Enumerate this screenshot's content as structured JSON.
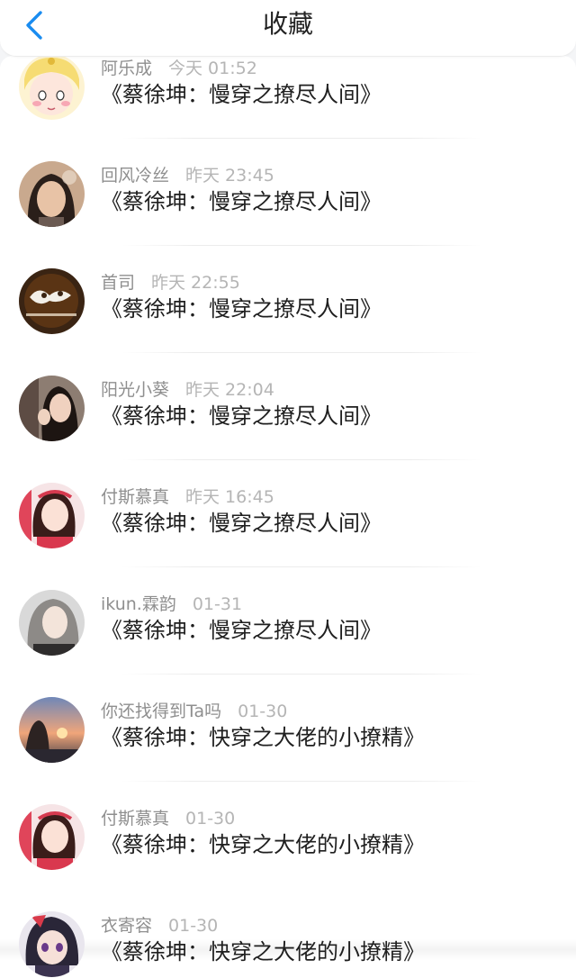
{
  "header": {
    "title": "收藏"
  },
  "items": [
    {
      "name": "阿乐成",
      "time": "今天 01:52",
      "work": "《蔡徐坤：慢穿之撩尽人间》",
      "avatar": "anime-girl-avatar"
    },
    {
      "name": "回风冷丝",
      "time": "昨天 23:45",
      "work": "《蔡徐坤：慢穿之撩尽人间》",
      "avatar": "woman-photo-avatar"
    },
    {
      "name": "首司",
      "time": "昨天 22:55",
      "work": "《蔡徐坤：慢穿之撩尽人间》",
      "avatar": "dark-logo-avatar"
    },
    {
      "name": "阳光小葵",
      "time": "昨天 22:04",
      "work": "《蔡徐坤：慢穿之撩尽人间》",
      "avatar": "girl-photo-avatar"
    },
    {
      "name": "付斯慕真",
      "time": "昨天 16:45",
      "work": "《蔡徐坤：慢穿之撩尽人间》",
      "avatar": "girl-red-avatar"
    },
    {
      "name": "ikun.霖韵",
      "time": "01-31",
      "work": "《蔡徐坤：慢穿之撩尽人间》",
      "avatar": "girl-grey-avatar"
    },
    {
      "name": "你还找得到Ta吗",
      "time": "01-30",
      "work": "《蔡徐坤：快穿之大佬的小撩精》",
      "avatar": "sunset-avatar"
    },
    {
      "name": "付斯慕真",
      "time": "01-30",
      "work": "《蔡徐坤：快穿之大佬的小撩精》",
      "avatar": "girl-red-avatar"
    },
    {
      "name": "衣寄容",
      "time": "01-30",
      "work": "《蔡徐坤：快穿之大佬的小撩精》",
      "avatar": "anime-dark-avatar"
    }
  ],
  "colors": {
    "accent": "#1a8cf0",
    "meta_name": "#8f8f8f",
    "meta_time": "#b5b5b5"
  }
}
